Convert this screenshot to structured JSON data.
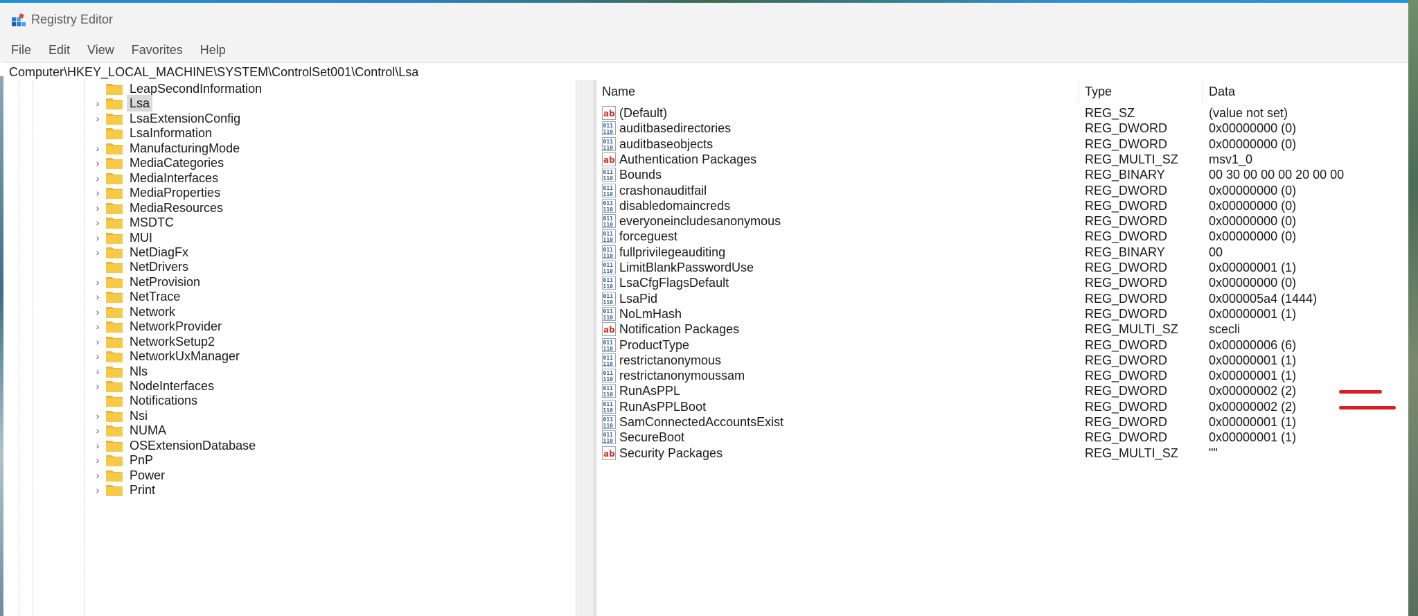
{
  "window": {
    "title": "Registry Editor"
  },
  "menu": [
    "File",
    "Edit",
    "View",
    "Favorites",
    "Help"
  ],
  "address": "Computer\\HKEY_LOCAL_MACHINE\\SYSTEM\\ControlSet001\\Control\\Lsa",
  "tree": [
    {
      "label": "LeapSecondInformation",
      "expandable": false
    },
    {
      "label": "Lsa",
      "expandable": true,
      "selected": true
    },
    {
      "label": "LsaExtensionConfig",
      "expandable": true
    },
    {
      "label": "LsaInformation",
      "expandable": false
    },
    {
      "label": "ManufacturingMode",
      "expandable": true
    },
    {
      "label": "MediaCategories",
      "expandable": true
    },
    {
      "label": "MediaInterfaces",
      "expandable": true
    },
    {
      "label": "MediaProperties",
      "expandable": true
    },
    {
      "label": "MediaResources",
      "expandable": true
    },
    {
      "label": "MSDTC",
      "expandable": true
    },
    {
      "label": "MUI",
      "expandable": true
    },
    {
      "label": "NetDiagFx",
      "expandable": true
    },
    {
      "label": "NetDrivers",
      "expandable": false
    },
    {
      "label": "NetProvision",
      "expandable": true
    },
    {
      "label": "NetTrace",
      "expandable": true
    },
    {
      "label": "Network",
      "expandable": true
    },
    {
      "label": "NetworkProvider",
      "expandable": true
    },
    {
      "label": "NetworkSetup2",
      "expandable": true
    },
    {
      "label": "NetworkUxManager",
      "expandable": true
    },
    {
      "label": "Nls",
      "expandable": true
    },
    {
      "label": "NodeInterfaces",
      "expandable": true
    },
    {
      "label": "Notifications",
      "expandable": false
    },
    {
      "label": "Nsi",
      "expandable": true
    },
    {
      "label": "NUMA",
      "expandable": true
    },
    {
      "label": "OSExtensionDatabase",
      "expandable": true
    },
    {
      "label": "PnP",
      "expandable": true
    },
    {
      "label": "Power",
      "expandable": true
    },
    {
      "label": "Print",
      "expandable": true
    }
  ],
  "columns": {
    "name": "Name",
    "type": "Type",
    "data": "Data"
  },
  "values": [
    {
      "icon": "string-value-icon",
      "name": "(Default)",
      "type": "REG_SZ",
      "data": "(value not set)"
    },
    {
      "icon": "binary-value-icon",
      "name": "auditbasedirectories",
      "type": "REG_DWORD",
      "data": "0x00000000 (0)"
    },
    {
      "icon": "binary-value-icon",
      "name": "auditbaseobjects",
      "type": "REG_DWORD",
      "data": "0x00000000 (0)"
    },
    {
      "icon": "string-value-icon",
      "name": "Authentication Packages",
      "type": "REG_MULTI_SZ",
      "data": "msv1_0"
    },
    {
      "icon": "binary-value-icon",
      "name": "Bounds",
      "type": "REG_BINARY",
      "data": "00 30 00 00 00 20 00 00"
    },
    {
      "icon": "binary-value-icon",
      "name": "crashonauditfail",
      "type": "REG_DWORD",
      "data": "0x00000000 (0)"
    },
    {
      "icon": "binary-value-icon",
      "name": "disabledomaincreds",
      "type": "REG_DWORD",
      "data": "0x00000000 (0)"
    },
    {
      "icon": "binary-value-icon",
      "name": "everyoneincludesanonymous",
      "type": "REG_DWORD",
      "data": "0x00000000 (0)"
    },
    {
      "icon": "binary-value-icon",
      "name": "forceguest",
      "type": "REG_DWORD",
      "data": "0x00000000 (0)"
    },
    {
      "icon": "binary-value-icon",
      "name": "fullprivilegeauditing",
      "type": "REG_BINARY",
      "data": "00"
    },
    {
      "icon": "binary-value-icon",
      "name": "LimitBlankPasswordUse",
      "type": "REG_DWORD",
      "data": "0x00000001 (1)"
    },
    {
      "icon": "binary-value-icon",
      "name": "LsaCfgFlagsDefault",
      "type": "REG_DWORD",
      "data": "0x00000000 (0)"
    },
    {
      "icon": "binary-value-icon",
      "name": "LsaPid",
      "type": "REG_DWORD",
      "data": "0x000005a4 (1444)"
    },
    {
      "icon": "binary-value-icon",
      "name": "NoLmHash",
      "type": "REG_DWORD",
      "data": "0x00000001 (1)"
    },
    {
      "icon": "string-value-icon",
      "name": "Notification Packages",
      "type": "REG_MULTI_SZ",
      "data": "scecli"
    },
    {
      "icon": "binary-value-icon",
      "name": "ProductType",
      "type": "REG_DWORD",
      "data": "0x00000006 (6)"
    },
    {
      "icon": "binary-value-icon",
      "name": "restrictanonymous",
      "type": "REG_DWORD",
      "data": "0x00000001 (1)"
    },
    {
      "icon": "binary-value-icon",
      "name": "restrictanonymoussam",
      "type": "REG_DWORD",
      "data": "0x00000001 (1)"
    },
    {
      "icon": "binary-value-icon",
      "name": "RunAsPPL",
      "type": "REG_DWORD",
      "data": "0x00000002 (2)",
      "marked": true
    },
    {
      "icon": "binary-value-icon",
      "name": "RunAsPPLBoot",
      "type": "REG_DWORD",
      "data": "0x00000002 (2)",
      "marked": true
    },
    {
      "icon": "binary-value-icon",
      "name": "SamConnectedAccountsExist",
      "type": "REG_DWORD",
      "data": "0x00000001 (1)"
    },
    {
      "icon": "binary-value-icon",
      "name": "SecureBoot",
      "type": "REG_DWORD",
      "data": "0x00000001 (1)"
    },
    {
      "icon": "string-value-icon",
      "name": "Security Packages",
      "type": "REG_MULTI_SZ",
      "data": "\"\""
    }
  ],
  "colors": {
    "selection": "#d9d9d9",
    "annotation": "#d81f26",
    "folder": "#f7c948"
  }
}
